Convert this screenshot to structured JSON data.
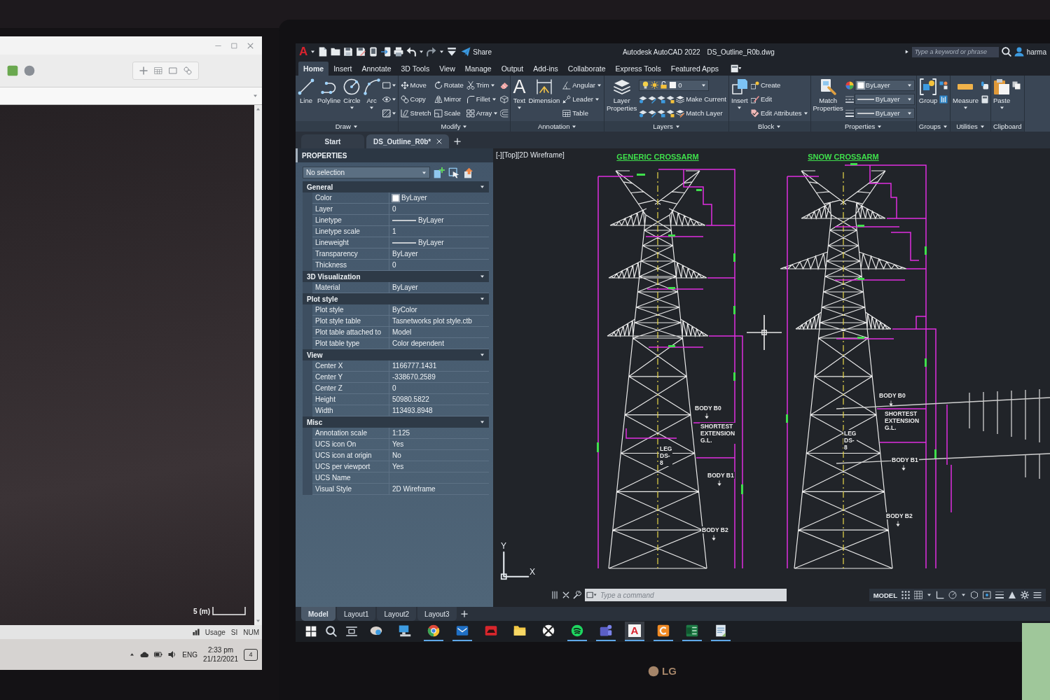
{
  "left_monitor": {
    "scale_label": "5 (m)",
    "status_items": [
      "Usage",
      "SI",
      "NUM"
    ],
    "language": "ENG",
    "time": "2:33 pm",
    "date": "21/12/2021",
    "notification_count": "4"
  },
  "title_bar": {
    "logo": "A",
    "share": "Share",
    "app_name": "Autodesk AutoCAD 2022",
    "file_name": "DS_Outline_R0b.dwg",
    "search": {
      "placeholder": "Type a keyword or phrase"
    },
    "user": "harma"
  },
  "ribbon_tabs": [
    {
      "label": "Home",
      "selected": true
    },
    {
      "label": "Insert",
      "selected": false
    },
    {
      "label": "Annotate",
      "selected": false
    },
    {
      "label": "3D Tools",
      "selected": false
    },
    {
      "label": "View",
      "selected": false
    },
    {
      "label": "Manage",
      "selected": false
    },
    {
      "label": "Output",
      "selected": false
    },
    {
      "label": "Add-ins",
      "selected": false
    },
    {
      "label": "Collaborate",
      "selected": false
    },
    {
      "label": "Express Tools",
      "selected": false
    },
    {
      "label": "Featured Apps",
      "selected": false
    }
  ],
  "ribbon_panels": [
    {
      "title": "Draw",
      "menu": true,
      "tools": [
        {
          "label": "Line",
          "kind": "large",
          "menu": false
        },
        {
          "label": "Polyline",
          "kind": "large",
          "menu": false
        },
        {
          "label": "Circle",
          "kind": "large",
          "menu": true
        },
        {
          "label": "Arc",
          "kind": "large",
          "menu": true
        }
      ]
    },
    {
      "title": "Modify",
      "menu": true,
      "tools": [
        {
          "label": "Move",
          "kind": "small",
          "menu": false
        },
        {
          "label": "Copy",
          "kind": "small",
          "menu": false
        },
        {
          "label": "Stretch",
          "kind": "small",
          "menu": false
        },
        {
          "label": "Rotate",
          "kind": "small",
          "menu": false
        },
        {
          "label": "Mirror",
          "kind": "small",
          "menu": false
        },
        {
          "label": "Scale",
          "kind": "small",
          "menu": false
        },
        {
          "label": "Trim",
          "kind": "small",
          "menu": true
        },
        {
          "label": "Fillet",
          "kind": "small",
          "menu": true
        },
        {
          "label": "Array",
          "kind": "small",
          "menu": true
        }
      ]
    },
    {
      "title": "Annotation",
      "menu": true,
      "tools": [
        {
          "label": "Text",
          "kind": "large",
          "menu": true,
          "glyph": "A"
        },
        {
          "label": "Dimension",
          "kind": "large",
          "menu": false
        },
        {
          "label": "Angular",
          "kind": "small",
          "menu": true
        },
        {
          "label": "Leader",
          "kind": "small",
          "menu": true
        },
        {
          "label": "Table",
          "kind": "small",
          "menu": false
        }
      ]
    },
    {
      "title": "Layers",
      "menu": true,
      "tools": [
        {
          "label": "Layer Properties",
          "kind": "large",
          "menu": false
        },
        {
          "value": "0",
          "kind": "layer_dropdown"
        },
        {
          "label": "Make Current",
          "kind": "small",
          "menu": false
        },
        {
          "label": "Match Layer",
          "kind": "small",
          "menu": false
        }
      ]
    },
    {
      "title": "Block",
      "menu": true,
      "tools": [
        {
          "label": "Insert",
          "kind": "large",
          "menu": true
        },
        {
          "label": "Create",
          "kind": "small",
          "menu": false
        },
        {
          "label": "Edit",
          "kind": "small",
          "menu": false
        },
        {
          "label": "Edit Attributes",
          "kind": "small",
          "menu": true
        }
      ]
    },
    {
      "title": "Properties",
      "menu": true,
      "tools": [
        {
          "label": "Match Properties",
          "kind": "large",
          "menu": false
        },
        {
          "value": "ByLayer",
          "kind": "color_dropdown"
        },
        {
          "value": "ByLayer",
          "kind": "line_dropdown"
        },
        {
          "value": "ByLayer",
          "kind": "line_dropdown"
        }
      ]
    },
    {
      "title": "Groups",
      "menu": true,
      "tools": [
        {
          "label": "Group",
          "kind": "large",
          "menu": false
        }
      ]
    },
    {
      "title": "Utilities",
      "menu": true,
      "tools": [
        {
          "label": "Measure",
          "kind": "large",
          "menu": true
        }
      ]
    },
    {
      "title": "Clipboard",
      "menu": false,
      "tools": [
        {
          "label": "Paste",
          "kind": "large",
          "menu": true
        }
      ]
    }
  ],
  "file_tabs": [
    {
      "label": "Start",
      "selected": false,
      "closable": false
    },
    {
      "label": "DS_Outline_R0b*",
      "selected": true,
      "closable": true
    }
  ],
  "properties_palette": {
    "title": "PROPERTIES",
    "selection": "No selection",
    "sections": [
      {
        "title": "General",
        "expanded": true,
        "rows": [
          {
            "label": "Color",
            "value": "ByLayer",
            "kind": "swatch"
          },
          {
            "label": "Layer",
            "value": "0",
            "kind": "text"
          },
          {
            "label": "Linetype",
            "value": "ByLayer",
            "kind": "line"
          },
          {
            "label": "Linetype scale",
            "value": "1",
            "kind": "text"
          },
          {
            "label": "Lineweight",
            "value": "ByLayer",
            "kind": "line"
          },
          {
            "label": "Transparency",
            "value": "ByLayer",
            "kind": "text"
          },
          {
            "label": "Thickness",
            "value": "0",
            "kind": "text"
          }
        ]
      },
      {
        "title": "3D Visualization",
        "expanded": true,
        "rows": [
          {
            "label": "Material",
            "value": "ByLayer",
            "kind": "text"
          }
        ]
      },
      {
        "title": "Plot style",
        "expanded": true,
        "rows": [
          {
            "label": "Plot style",
            "value": "ByColor",
            "kind": "text"
          },
          {
            "label": "Plot style table",
            "value": "Tasnetworks plot style.ctb",
            "kind": "text"
          },
          {
            "label": "Plot table attached to",
            "value": "Model",
            "kind": "text"
          },
          {
            "label": "Plot table type",
            "value": "Color dependent",
            "kind": "text"
          }
        ]
      },
      {
        "title": "View",
        "expanded": true,
        "rows": [
          {
            "label": "Center X",
            "value": "1166777.1431",
            "kind": "text"
          },
          {
            "label": "Center Y",
            "value": "-338670.2589",
            "kind": "text"
          },
          {
            "label": "Center Z",
            "value": "0",
            "kind": "text"
          },
          {
            "label": "Height",
            "value": "50980.5822",
            "kind": "text"
          },
          {
            "label": "Width",
            "value": "113493.8948",
            "kind": "text"
          }
        ]
      },
      {
        "title": "Misc",
        "expanded": true,
        "rows": [
          {
            "label": "Annotation scale",
            "value": "1:125",
            "kind": "text"
          },
          {
            "label": "UCS icon On",
            "value": "Yes",
            "kind": "text"
          },
          {
            "label": "UCS icon at origin",
            "value": "No",
            "kind": "text"
          },
          {
            "label": "UCS per viewport",
            "value": "Yes",
            "kind": "text"
          },
          {
            "label": "UCS Name",
            "kind": "text"
          },
          {
            "label": "Visual Style",
            "value": "2D Wireframe",
            "kind": "text"
          }
        ]
      }
    ]
  },
  "drawing": {
    "viewport_label": "[-][Top][2D Wireframe]",
    "towers": [
      {
        "title": "GENERIC CROSSARM",
        "labels": [
          {
            "text": "BODY B0",
            "kind": "level"
          },
          {
            "text": "SHORTEST EXTENSION G.L.",
            "kind": "note"
          },
          {
            "text": "LEG DS-8",
            "kind": "note"
          },
          {
            "text": "BODY B1",
            "kind": "level"
          },
          {
            "text": "BODY B2",
            "kind": "level"
          }
        ]
      },
      {
        "title": "SNOW CROSSARM",
        "labels": [
          {
            "text": "BODY B0",
            "kind": "level"
          },
          {
            "text": "SHORTEST EXTENSION G.L.",
            "kind": "note"
          },
          {
            "text": "LEG DS-8",
            "kind": "note"
          },
          {
            "text": "BODY B1",
            "kind": "level"
          },
          {
            "text": "BODY B2",
            "kind": "level"
          }
        ]
      }
    ],
    "ucs": {
      "x": "X",
      "y": "Y"
    }
  },
  "command_line": {
    "placeholder": "Type a command"
  },
  "status_bar": {
    "mode": "MODEL"
  },
  "layout_tabs": [
    {
      "label": "Model",
      "selected": true
    },
    {
      "label": "Layout1",
      "selected": false
    },
    {
      "label": "Layout2",
      "selected": false
    },
    {
      "label": "Layout3",
      "selected": false
    }
  ],
  "taskbar": {
    "apps": [
      {
        "running": false,
        "selected": false
      },
      {
        "running": false,
        "selected": false
      },
      {
        "running": true,
        "selected": false
      },
      {
        "running": true,
        "selected": false
      },
      {
        "running": false,
        "selected": false
      },
      {
        "running": false,
        "selected": false
      },
      {
        "running": false,
        "selected": false
      },
      {
        "running": true,
        "selected": false
      },
      {
        "running": true,
        "selected": false
      },
      {
        "running": true,
        "selected": true,
        "glyph": "A"
      },
      {
        "running": true,
        "selected": false
      },
      {
        "running": true,
        "selected": false
      },
      {
        "running": true,
        "selected": false
      }
    ]
  },
  "monitor": {
    "brand": "LG"
  }
}
